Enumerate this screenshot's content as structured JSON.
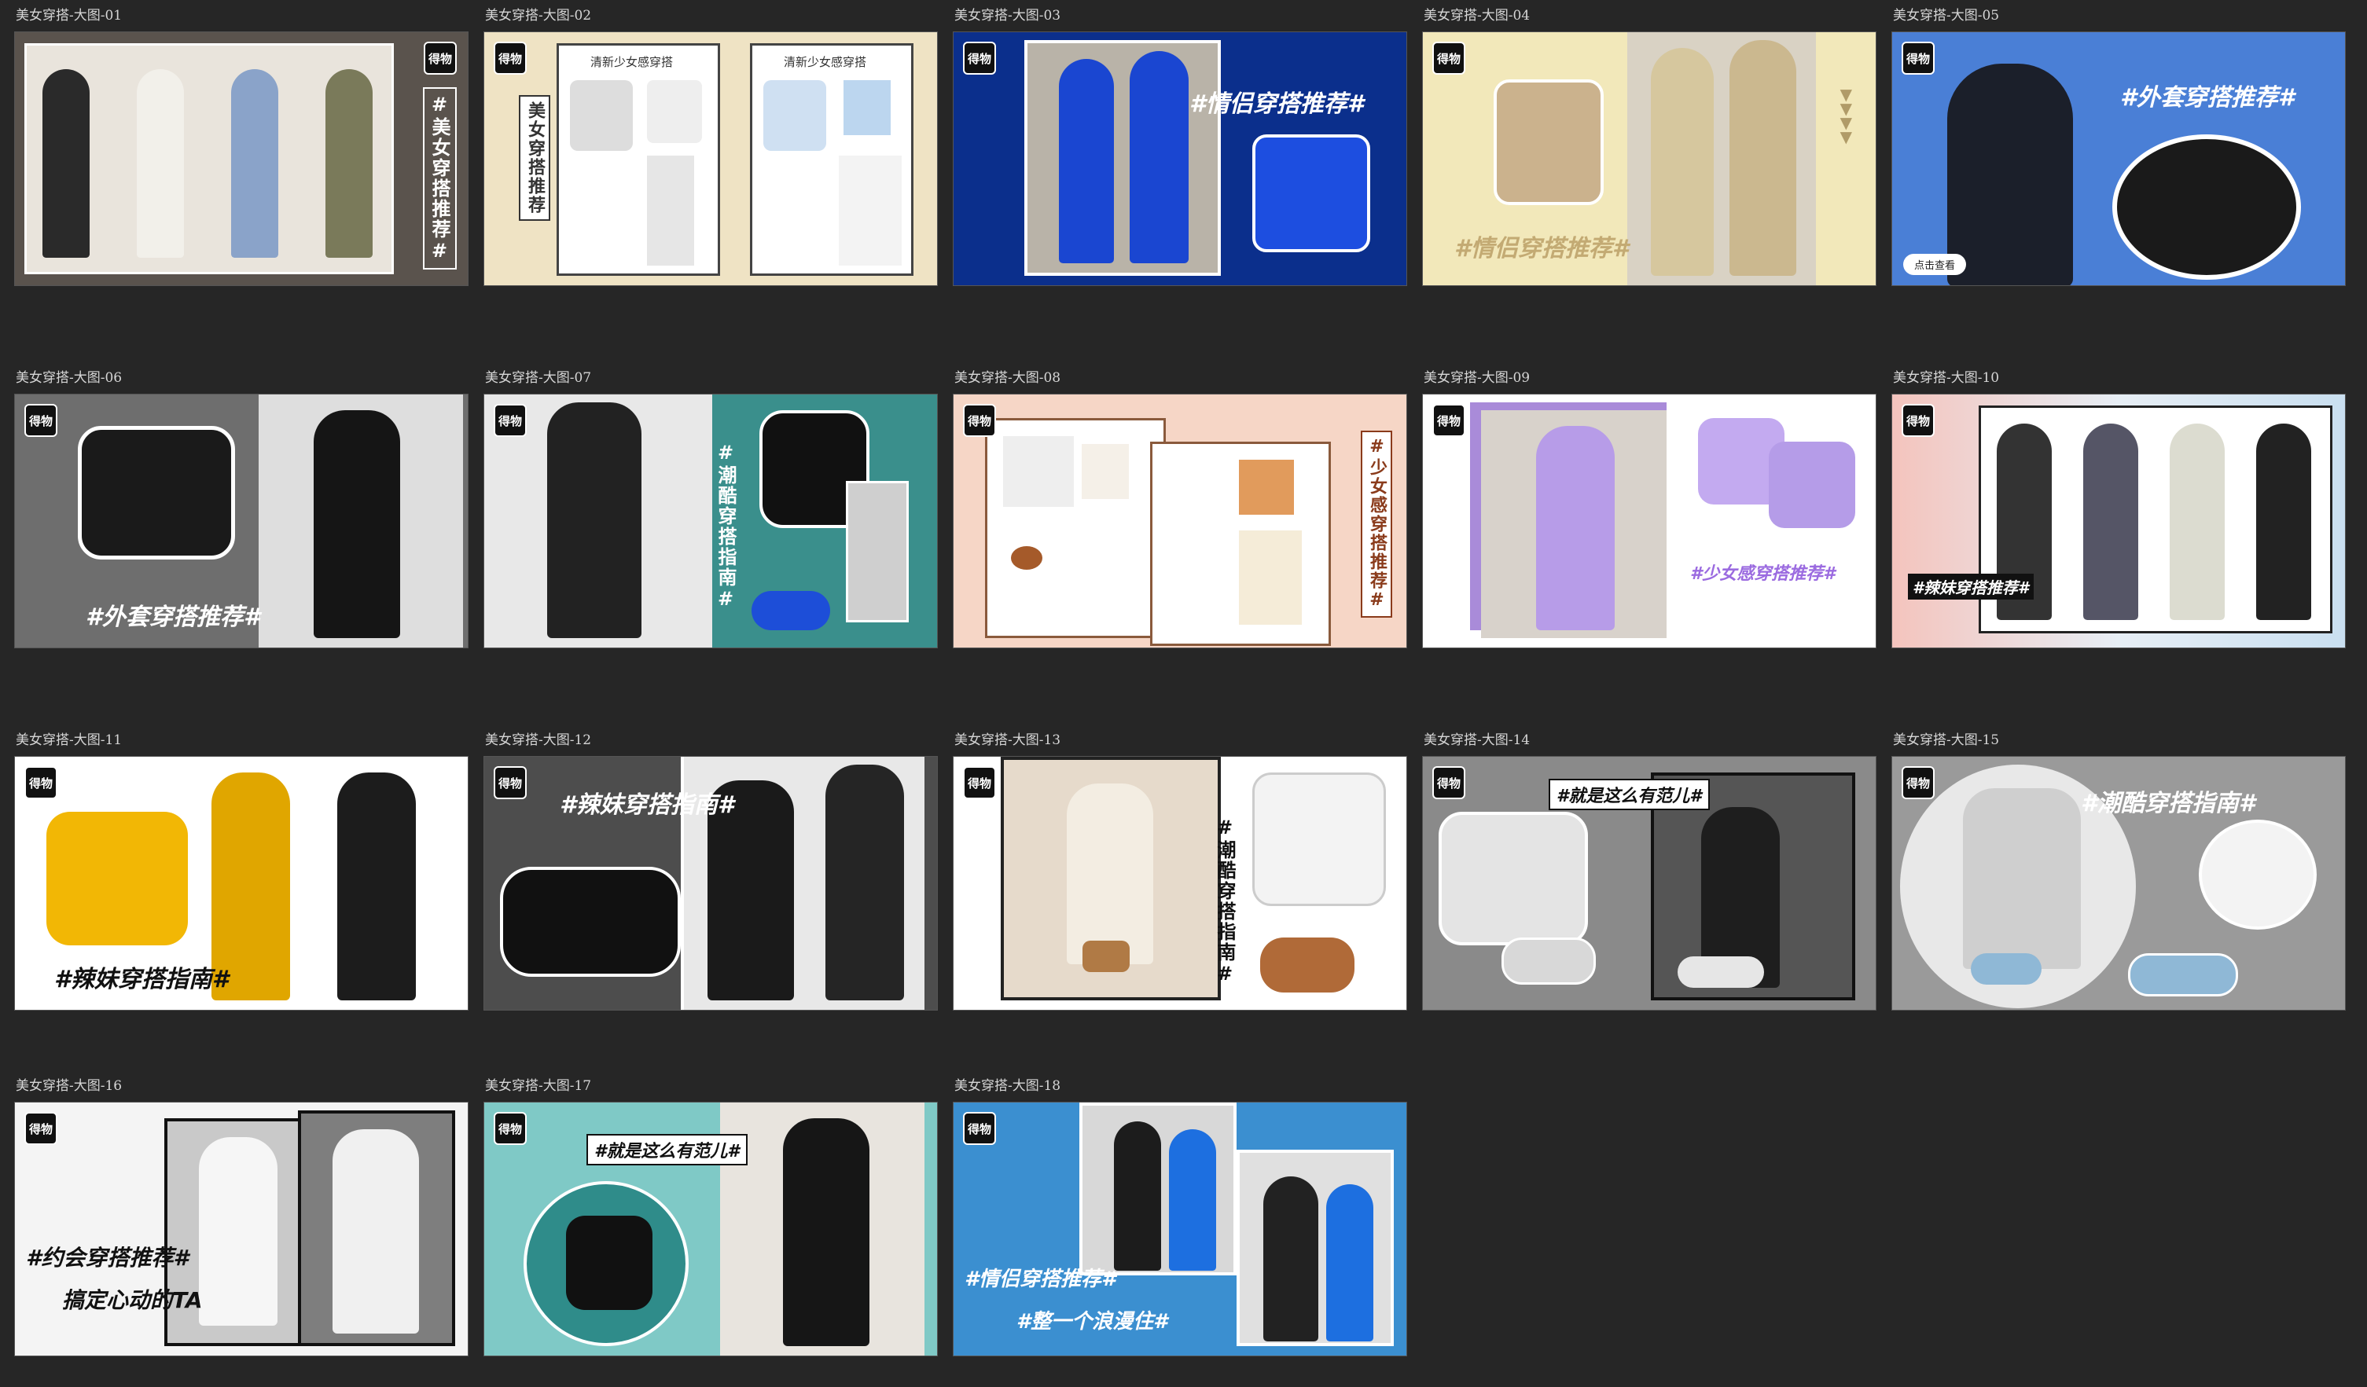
{
  "board": {
    "title": "",
    "tiles": [
      {
        "label": "美女穿搭-大图-01",
        "logo": "得物",
        "tag": "#美女穿搭推荐#"
      },
      {
        "label": "美女穿搭-大图-02",
        "logo": "得物",
        "tag": "美女穿搭推荐",
        "cap1": "清新少女感穿搭",
        "cap2": "清新少女感穿搭"
      },
      {
        "label": "美女穿搭-大图-03",
        "logo": "得物",
        "tag": "#情侣穿搭推荐#"
      },
      {
        "label": "美女穿搭-大图-04",
        "logo": "得物",
        "tag": "#情侣穿搭推荐#"
      },
      {
        "label": "美女穿搭-大图-05",
        "logo": "得物",
        "tag": "#外套穿搭推荐#",
        "button": "点击查看"
      },
      {
        "label": "美女穿搭-大图-06",
        "logo": "得物",
        "tag": "#外套穿搭推荐#"
      },
      {
        "label": "美女穿搭-大图-07",
        "logo": "得物",
        "tag": "#潮酷穿搭指南#"
      },
      {
        "label": "美女穿搭-大图-08",
        "logo": "得物",
        "tag": "#少女感穿搭推荐#"
      },
      {
        "label": "美女穿搭-大图-09",
        "logo": "得物",
        "tag": "#少女感穿搭推荐#"
      },
      {
        "label": "美女穿搭-大图-10",
        "logo": "得物",
        "tag": "#辣妹穿搭推荐#"
      },
      {
        "label": "美女穿搭-大图-11",
        "logo": "得物",
        "tag": "#辣妹穿搭指南#"
      },
      {
        "label": "美女穿搭-大图-12",
        "logo": "得物",
        "tag": "#辣妹穿搭指南#"
      },
      {
        "label": "美女穿搭-大图-13",
        "logo": "得物",
        "tag": "#潮酷穿搭指南#"
      },
      {
        "label": "美女穿搭-大图-14",
        "logo": "得物",
        "tag": "#就是这么有范儿#"
      },
      {
        "label": "美女穿搭-大图-15",
        "logo": "得物",
        "tag": "#潮酷穿搭指南#"
      },
      {
        "label": "美女穿搭-大图-16",
        "logo": "得物",
        "tag": "#约会穿搭推荐#",
        "sub": "搞定心动的TA"
      },
      {
        "label": "美女穿搭-大图-17",
        "logo": "得物",
        "tag": "#就是这么有范儿#"
      },
      {
        "label": "美女穿搭-大图-18",
        "logo": "得物",
        "tag": "#情侣穿搭推荐#",
        "sub": "#整一个浪漫住#"
      }
    ]
  },
  "colors": {
    "background": "#262626",
    "tile03_bg": "#0b2f8c",
    "tile05_bg": "#4a7fd6",
    "tile07_bg": "#3a8f8c",
    "tile09_accent": "#a98bd9",
    "tile11_accent": "#f2b705",
    "tile18_bg": "#3b8fd0"
  }
}
